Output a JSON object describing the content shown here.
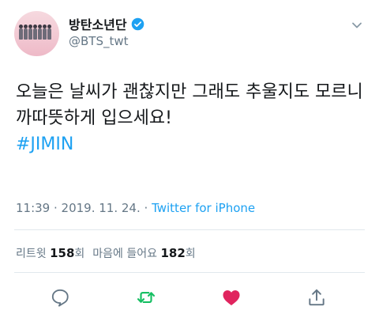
{
  "user": {
    "display_name": "방탄소년단",
    "handle": "@BTS_twt",
    "verified": true
  },
  "tweet": {
    "text": "오늘은 날씨가 괜찮지만 그래도 추울지도 모르니까따뜻하게 입으세요!",
    "hashtag": "#JIMIN"
  },
  "meta": {
    "time": "11:39",
    "sep1": " · ",
    "date": "2019. 11. 24.",
    "sep2": " · ",
    "source": "Twitter for iPhone"
  },
  "stats": {
    "retweets_label": "리트윗",
    "retweets_count": "158",
    "retweets_unit": "회",
    "likes_label": "마음에 들어요",
    "likes_count": "182",
    "likes_unit": "회"
  },
  "actions": {
    "reply": "reply-icon",
    "retweet": "retweet-icon",
    "like": "heart-icon",
    "share": "share-icon"
  },
  "colors": {
    "link": "#1da1f2",
    "retweet": "#17bf63",
    "like": "#e0245e",
    "muted": "#657786"
  }
}
